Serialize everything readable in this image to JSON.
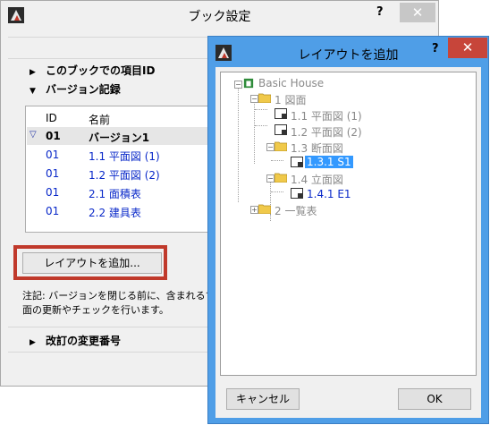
{
  "main_window": {
    "title": "ブック設定",
    "help_label": "?",
    "close_label": "✕",
    "sections": {
      "item_id": "このブックでの項目ID",
      "version_history": "バージョン記録",
      "revision_number": "改訂の変更番号"
    },
    "table": {
      "columns": [
        "ID",
        "名前"
      ],
      "group_row": {
        "id": "01",
        "name": "バージョン1"
      },
      "rows": [
        {
          "id": "01",
          "name": "1.1 平面図 (1)"
        },
        {
          "id": "01",
          "name": "1.2 平面図 (2)"
        },
        {
          "id": "01",
          "name": "2.1 面積表"
        },
        {
          "id": "01",
          "name": "2.2 建具表"
        }
      ]
    },
    "add_layout_button": "レイアウトを追加...",
    "note_line1": "注記: バージョンを閉じる前に、含まれるすべての",
    "note_line2": "面の更新やチェックを行います。"
  },
  "dialog": {
    "title": "レイアウトを追加",
    "help_label": "?",
    "close_label": "✕",
    "tree": {
      "root": "Basic House",
      "folder1": "1 図面",
      "item_1_1": "1.1 平面図 (1)",
      "item_1_2": "1.2 平面図 (2)",
      "folder_1_3": "1.3 断面図",
      "item_1_3_1": "1.3.1 S1",
      "folder_1_4": "1.4 立面図",
      "item_1_4_1": "1.4.1 E1",
      "folder2": "2 一覧表"
    },
    "cancel_button": "キャンセル",
    "ok_button": "OK"
  },
  "colors": {
    "dialog_frame": "#4f9ee7",
    "close_red": "#c7453a",
    "highlight_box": "#c0392b",
    "link_blue": "#0a29c9",
    "selection_blue": "#3399ff"
  }
}
